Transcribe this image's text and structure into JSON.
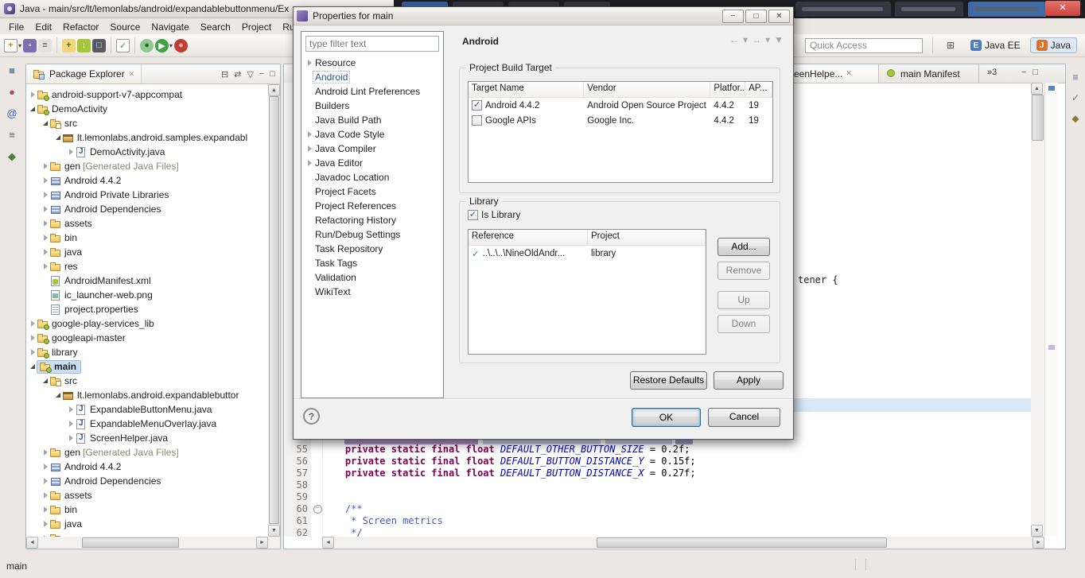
{
  "colors": {
    "keyword": "#7F0055",
    "static_field": "#0000C0",
    "javadoc": "#3F5FBF",
    "selection": "#C9DEF5",
    "selection_border": "#9CBEE0",
    "android_green": "#A4C639",
    "close_red": "#C8423C",
    "link": "#2155A4",
    "ok_glow": "#7EB4E2"
  },
  "window": {
    "title": "Java - main/src/lt/lemonlabs/android/expandablebuttonmenu/Ex",
    "menu_items": [
      "File",
      "Edit",
      "Refactor",
      "Source",
      "Navigate",
      "Search",
      "Project",
      "Run"
    ],
    "quick_access_placeholder": "Quick Access",
    "perspectives": [
      {
        "label": "Java EE",
        "active": false,
        "icon_glyph": "E",
        "icon_bg": "#4E7FB8"
      },
      {
        "label": "Java",
        "active": true,
        "icon_glyph": "J",
        "icon_bg": "#D8742E"
      }
    ]
  },
  "toolbar": {
    "icons": [
      {
        "name": "new-wizard-icon",
        "shape": "page",
        "glyph": "+",
        "fg": "#C08A00",
        "caret": true
      },
      {
        "name": "save-icon",
        "shape": "square",
        "glyph": "▫",
        "bg": "#7B6FB0",
        "fg": "#FFFFFF"
      },
      {
        "name": "print-icon",
        "shape": "square",
        "glyph": "≡",
        "bg": "#E4E2DE",
        "fg": "#555555"
      },
      {
        "sep": true
      },
      {
        "name": "new-android-project-icon",
        "shape": "square",
        "glyph": "+",
        "bg": "#F6D47C",
        "fg": "#3E7D1F"
      },
      {
        "name": "android-sdk-manager-icon",
        "shape": "square",
        "glyph": "↓",
        "bg": "#A4C639",
        "fg": "#FFFFFF"
      },
      {
        "name": "avd-manager-icon",
        "shape": "square",
        "glyph": "□",
        "bg": "#5A5A64",
        "fg": "#CFE6FF"
      },
      {
        "sep": true
      },
      {
        "name": "lint-check-icon",
        "shape": "page",
        "glyph": "✓",
        "fg": "#2FA12F"
      },
      {
        "sep": true
      },
      {
        "name": "debug-icon",
        "shape": "circle",
        "glyph": "●",
        "bg": "#8FC98F",
        "fg": "#2E6B2E"
      },
      {
        "name": "run-icon",
        "shape": "circle",
        "glyph": "▶",
        "bg": "#3FA43F",
        "fg": "#FFFFFF",
        "caret": true
      },
      {
        "name": "external-tools-icon",
        "shape": "circle",
        "glyph": "●",
        "bg": "#C23B35",
        "fg": "#E9B3B0"
      }
    ]
  },
  "left_toolbar": {
    "icons": [
      {
        "name": "views-grid-icon",
        "glyph": "■",
        "fg": "#7A8CA8"
      },
      {
        "name": "breakpoints-icon",
        "glyph": "●",
        "fg": "#B05050"
      },
      {
        "name": "javadoc-icon",
        "glyph": "@",
        "fg": "#3F5FBF"
      },
      {
        "name": "console-icon",
        "glyph": "≡",
        "fg": "#666666"
      },
      {
        "name": "ddms-icon",
        "glyph": "◆",
        "fg": "#4F7F3F"
      }
    ]
  },
  "right_toolbar": {
    "icons": [
      {
        "name": "minimized-outline-view-icon",
        "glyph": "≡",
        "fg": "#5A6B8C"
      },
      {
        "name": "minimized-task-list-icon",
        "glyph": "✓",
        "fg": "#7A7A7A"
      },
      {
        "name": "minimized-ant-view-icon",
        "glyph": "◆",
        "fg": "#8A7A3A"
      }
    ]
  },
  "package_explorer": {
    "title": "Package Explorer",
    "tools": [
      {
        "name": "collapse-all-icon",
        "glyph": "⊟"
      },
      {
        "name": "link-with-editor-icon",
        "glyph": "⇄"
      },
      {
        "name": "view-menu-icon",
        "glyph": "▽"
      },
      {
        "name": "minimize-icon",
        "glyph": "−"
      },
      {
        "name": "maximize-icon",
        "glyph": "□"
      }
    ],
    "items": [
      {
        "d": 0,
        "a": "c",
        "i": "project",
        "t": "android-support-v7-appcompat"
      },
      {
        "d": 0,
        "a": "e",
        "i": "project",
        "t": "DemoActivity"
      },
      {
        "d": 1,
        "a": "e",
        "i": "srcfolder",
        "t": "src"
      },
      {
        "d": 2,
        "a": "e",
        "i": "package",
        "t": "lt.lemonlabs.android.samples.expandabl"
      },
      {
        "d": 3,
        "a": "c",
        "i": "javafile",
        "t": "DemoActivity.java"
      },
      {
        "d": 1,
        "a": "c",
        "i": "folder",
        "t": "gen",
        "x": " [Generated Java Files]"
      },
      {
        "d": 1,
        "a": "c",
        "i": "library",
        "t": "Android 4.4.2"
      },
      {
        "d": 1,
        "a": "c",
        "i": "library",
        "t": "Android Private Libraries"
      },
      {
        "d": 1,
        "a": "c",
        "i": "library",
        "t": "Android Dependencies"
      },
      {
        "d": 1,
        "a": "c",
        "i": "folder",
        "t": "assets"
      },
      {
        "d": 1,
        "a": "c",
        "i": "folder",
        "t": "bin"
      },
      {
        "d": 1,
        "a": "c",
        "i": "folder",
        "t": "java"
      },
      {
        "d": 1,
        "a": "c",
        "i": "folder",
        "t": "res"
      },
      {
        "d": 1,
        "a": "",
        "i": "xmlfile",
        "t": "AndroidManifest.xml"
      },
      {
        "d": 1,
        "a": "",
        "i": "imgfile",
        "t": "ic_launcher-web.png"
      },
      {
        "d": 1,
        "a": "",
        "i": "propsfile",
        "t": "project.properties"
      },
      {
        "d": 0,
        "a": "c",
        "i": "project",
        "t": "google-play-services_lib"
      },
      {
        "d": 0,
        "a": "c",
        "i": "project",
        "t": "googleapi-master"
      },
      {
        "d": 0,
        "a": "c",
        "i": "project",
        "t": "library"
      },
      {
        "d": 0,
        "a": "e",
        "i": "project",
        "t": "main",
        "sel": true
      },
      {
        "d": 1,
        "a": "e",
        "i": "srcfolder",
        "t": "src"
      },
      {
        "d": 2,
        "a": "e",
        "i": "package",
        "t": "lt.lemonlabs.android.expandablebuttor"
      },
      {
        "d": 3,
        "a": "c",
        "i": "javafile",
        "t": "ExpandableButtonMenu.java"
      },
      {
        "d": 3,
        "a": "c",
        "i": "javafile",
        "t": "ExpandableMenuOverlay.java"
      },
      {
        "d": 3,
        "a": "c",
        "i": "javafile",
        "t": "ScreenHelper.java"
      },
      {
        "d": 1,
        "a": "c",
        "i": "folder",
        "t": "gen",
        "x": " [Generated Java Files]"
      },
      {
        "d": 1,
        "a": "c",
        "i": "library",
        "t": "Android 4.4.2"
      },
      {
        "d": 1,
        "a": "c",
        "i": "library",
        "t": "Android Dependencies"
      },
      {
        "d": 1,
        "a": "c",
        "i": "folder",
        "t": "assets"
      },
      {
        "d": 1,
        "a": "c",
        "i": "folder",
        "t": "bin"
      },
      {
        "d": 1,
        "a": "c",
        "i": "folder",
        "t": "java"
      },
      {
        "d": 1,
        "a": "c",
        "i": "folder",
        "t": ""
      }
    ]
  },
  "editor": {
    "tabs": [
      {
        "label": "ScreenHelpe...",
        "icon": "javafile",
        "selected": true,
        "closable": true
      },
      {
        "label": "main Manifest",
        "icon": "android",
        "selected": false
      }
    ],
    "overflow_count": "»3",
    "controls": [
      {
        "name": "minimize-icon",
        "glyph": "−"
      },
      {
        "name": "maximize-icon",
        "glyph": "□"
      }
    ],
    "background_fragment": "tener {",
    "code": {
      "lines": [
        {
          "n": "55",
          "parts": [
            [
              "p",
              "    "
            ],
            [
              "k",
              "private static final float"
            ],
            [
              "p",
              " "
            ],
            [
              "f",
              "DEFAULT_OTHER_BUTTON_SIZE"
            ],
            [
              "p",
              " = 0.2f;"
            ]
          ]
        },
        {
          "n": "56",
          "parts": [
            [
              "p",
              "    "
            ],
            [
              "k",
              "private static final float"
            ],
            [
              "p",
              " "
            ],
            [
              "f",
              "DEFAULT_BUTTON_DISTANCE_Y"
            ],
            [
              "p",
              " = 0.15f;"
            ]
          ]
        },
        {
          "n": "57",
          "parts": [
            [
              "p",
              "    "
            ],
            [
              "k",
              "private static final float"
            ],
            [
              "p",
              " "
            ],
            [
              "f",
              "DEFAULT_BUTTON_DISTANCE_X"
            ],
            [
              "p",
              " = 0.27f;"
            ]
          ]
        },
        {
          "n": "58",
          "parts": []
        },
        {
          "n": "59",
          "parts": []
        },
        {
          "n": "60",
          "fold": true,
          "parts": [
            [
              "d",
              "    /**"
            ]
          ]
        },
        {
          "n": "61",
          "parts": [
            [
              "d",
              "     * Screen metrics"
            ]
          ]
        },
        {
          "n": "62",
          "parts": [
            [
              "d",
              "     */"
            ]
          ]
        }
      ]
    }
  },
  "status_bar": {
    "text": "main"
  },
  "dialog": {
    "title": "Properties for main",
    "window_buttons": [
      {
        "name": "dialog-minimize-button",
        "glyph": "−"
      },
      {
        "name": "dialog-maximize-button",
        "glyph": "□"
      },
      {
        "name": "dialog-close-button",
        "glyph": "✕"
      }
    ],
    "filter_placeholder": "type filter text",
    "tree": [
      {
        "t": "Resource",
        "a": true
      },
      {
        "t": "Android",
        "sel": true
      },
      {
        "t": "Android Lint Preferences"
      },
      {
        "t": "Builders"
      },
      {
        "t": "Java Build Path"
      },
      {
        "t": "Java Code Style",
        "a": true
      },
      {
        "t": "Java Compiler",
        "a": true
      },
      {
        "t": "Java Editor",
        "a": true
      },
      {
        "t": "Javadoc Location"
      },
      {
        "t": "Project Facets"
      },
      {
        "t": "Project References"
      },
      {
        "t": "Refactoring History"
      },
      {
        "t": "Run/Debug Settings"
      },
      {
        "t": "Task Repository"
      },
      {
        "t": "Task Tags"
      },
      {
        "t": "Validation"
      },
      {
        "t": "WikiText"
      }
    ],
    "page_title": "Android",
    "nav_icons": [
      {
        "name": "back-icon",
        "glyph": "←"
      },
      {
        "name": "back-menu-icon",
        "glyph": "▾"
      },
      {
        "name": "forward-icon",
        "glyph": "→"
      },
      {
        "name": "forward-menu-icon",
        "glyph": "▾"
      },
      {
        "name": "page-menu-icon",
        "glyph": "▼"
      }
    ],
    "build_target": {
      "label": "Project Build Target",
      "columns": [
        "Target Name",
        "Vendor",
        "Platfor...",
        "AP..."
      ],
      "rows": [
        {
          "checked": true,
          "target": "Android 4.4.2",
          "vendor": "Android Open Source Project",
          "platform": "4.4.2",
          "api": "19"
        },
        {
          "checked": false,
          "target": "Google APIs",
          "vendor": "Google Inc.",
          "platform": "4.4.2",
          "api": "19"
        }
      ]
    },
    "library": {
      "label": "Library",
      "is_library": {
        "checked": true,
        "label": "Is Library"
      },
      "columns": [
        "Reference",
        "Project"
      ],
      "rows": [
        {
          "reference": "..\\..\\..\\NineOldAndr...",
          "project": "library"
        }
      ],
      "buttons": [
        {
          "label": "Add...",
          "enabled": true
        },
        {
          "label": "Remove",
          "enabled": false
        },
        {
          "label": "Up",
          "enabled": false
        },
        {
          "label": "Down",
          "enabled": false
        }
      ]
    },
    "restore_defaults": "Restore Defaults",
    "apply": "Apply",
    "help": "?",
    "ok": "OK",
    "cancel": "Cancel"
  }
}
